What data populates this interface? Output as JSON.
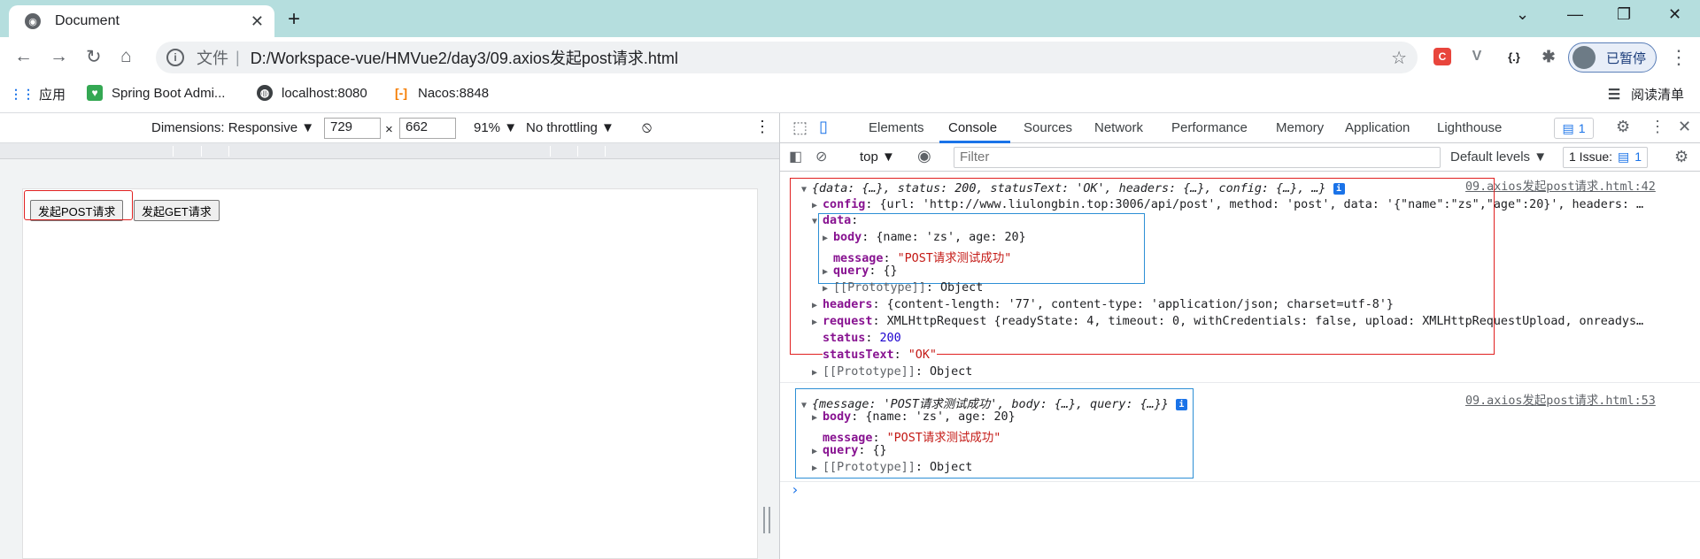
{
  "browser": {
    "tab_title": "Document",
    "omnibox_scheme": "文件",
    "omnibox_url": "D:/Workspace-vue/HMVue2/day3/09.axios发起post请求.html",
    "profile_label": "已暂停",
    "ext_c": "C",
    "ext_v": "V",
    "ext_braces": "{.}"
  },
  "bookmarks": {
    "items": [
      {
        "label": "应用",
        "icon": "apps-grid-icon"
      },
      {
        "label": "Spring Boot Admi...",
        "icon": "spring-boot-icon"
      },
      {
        "label": "localhost:8080",
        "icon": "globe-icon"
      },
      {
        "label": "Nacos:8848",
        "icon": "nacos-icon"
      }
    ],
    "reading_list": "阅读清单"
  },
  "device_toolbar": {
    "dimensions_label": "Dimensions: Responsive ▼",
    "width": "729",
    "times": "×",
    "height": "662",
    "zoom": "91% ▼",
    "throttling": "No throttling ▼"
  },
  "page": {
    "post_button": "发起POST请求",
    "get_button": "发起GET请求"
  },
  "devtools": {
    "tabs": [
      "Elements",
      "Console",
      "Sources",
      "Network",
      "Performance",
      "Memory",
      "Application",
      "Lighthouse"
    ],
    "active_tab": "Console",
    "issues_count": "1",
    "context": "top ▼",
    "filter_placeholder": "Filter",
    "levels": "Default levels ▼",
    "issue_label": "1 Issue:",
    "issue_count": "1"
  },
  "console": {
    "log1": {
      "source": "09.axios发起post请求.html:42",
      "summary": "{data: {…}, status: 200, statusText: 'OK', headers: {…}, config: {…}, …}",
      "config_key": "config",
      "config_val": "{url: 'http://www.liulongbin.top:3006/api/post', method: 'post', data: '{\"name\":\"zs\",\"age\":20}', headers: …",
      "data_key": "data",
      "body_key": "body",
      "body_val": "{name: 'zs', age: 20}",
      "message_key": "message",
      "message_val": "\"POST请求测试成功\"",
      "query_key": "query",
      "query_val": "{}",
      "proto_key": "[[Prototype]]",
      "proto_val": "Object",
      "headers_key": "headers",
      "headers_val": "{content-length: '77', content-type: 'application/json; charset=utf-8'}",
      "request_key": "request",
      "request_val": "XMLHttpRequest {readyState: 4, timeout: 0, withCredentials: false, upload: XMLHttpRequestUpload, onreadys…",
      "status_key": "status",
      "status_val": "200",
      "statusText_key": "statusText",
      "statusText_val": "\"OK\"",
      "proto2_key": "[[Prototype]]",
      "proto2_val": "Object"
    },
    "log2": {
      "source": "09.axios发起post请求.html:53",
      "summary": "{message: 'POST请求测试成功', body: {…}, query: {…}}",
      "body_key": "body",
      "body_val": "{name: 'zs', age: 20}",
      "message_key": "message",
      "message_val": "\"POST请求测试成功\"",
      "query_key": "query",
      "query_val": "{}",
      "proto_key": "[[Prototype]]",
      "proto_val": "Object"
    },
    "prompt": "›"
  },
  "colors": {
    "tabstrip": "#b5dede",
    "accent": "#1a73e8",
    "highlight_red": "#e02020",
    "highlight_blue": "#2d8fd5"
  }
}
